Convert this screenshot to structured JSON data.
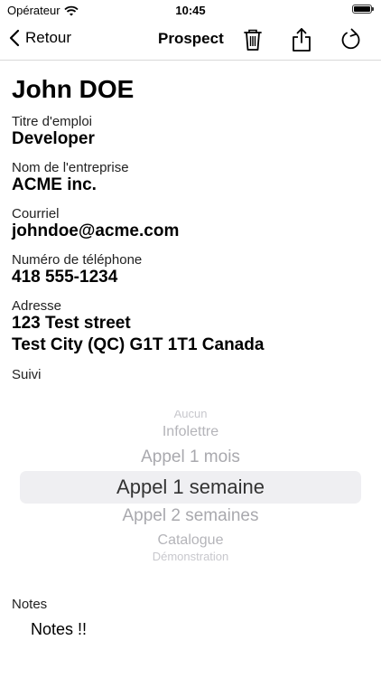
{
  "status_bar": {
    "carrier": "Opérateur",
    "time": "10:45"
  },
  "nav": {
    "back_label": "Retour",
    "title": "Prospect"
  },
  "contact": {
    "name": "John DOE",
    "fields": [
      {
        "label": "Titre d'emploi",
        "value": "Developer"
      },
      {
        "label": "Nom de l'entreprise",
        "value": "ACME inc."
      },
      {
        "label": "Courriel",
        "value": "johndoe@acme.com"
      },
      {
        "label": "Numéro de téléphone",
        "value": "418 555-1234"
      }
    ],
    "address": {
      "label": "Adresse",
      "line1": "123 Test street",
      "line2": "Test City (QC) G1T 1T1 Canada"
    }
  },
  "followup": {
    "label": "Suivi",
    "options": [
      "Aucun",
      "Infolettre",
      "Appel 1 mois",
      "Appel 1 semaine",
      "Appel 2 semaines",
      "Catalogue",
      "Démonstration"
    ],
    "selected": "Appel 1 semaine"
  },
  "notes": {
    "label": "Notes",
    "value": "Notes !!"
  }
}
